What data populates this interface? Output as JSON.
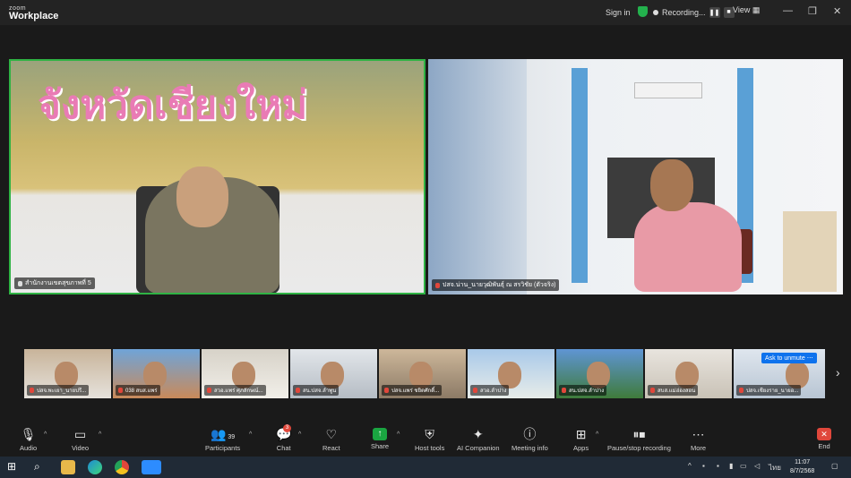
{
  "app": {
    "brand_small": "zoom",
    "brand_large": "Workplace"
  },
  "titlebar": {
    "signin": "Sign in",
    "recording": "Recording...",
    "view": "View"
  },
  "main_tiles": [
    {
      "banner": "จังหวัดเชียงใหม่",
      "name": "สำนักงานเขตสุขภาพที่ 5"
    },
    {
      "name": "ปสจ.น่าน_นายวุฒิพันธุ์ ณ สรวิชัย (ตัวจริง)"
    }
  ],
  "thumbnails": [
    "ปสจ.พะเยา_นายปรี...",
    "038 สบส.แพร่",
    "สวอ.แพร่ ศุภลักษณ์...",
    "สน.ปสจ.ลำพูน",
    "ปสจ.แพร่ ชยิตศักดิ์...",
    "สวอ.ลำปาง",
    "สน.ปสจ.ลำปาง",
    "สบส.แม่ฮ่องสอน",
    "ปสจ.เชียงราย_นายอ..."
  ],
  "ask_to_unmute": "Ask to unmute",
  "toolbar": {
    "audio": "Audio",
    "video": "Video",
    "participants": "Participants",
    "participants_count": "39",
    "chat": "Chat",
    "chat_badge": "3",
    "react": "React",
    "share": "Share",
    "host_tools": "Host tools",
    "ai_companion": "AI Companion",
    "meeting_info": "Meeting info",
    "apps": "Apps",
    "pause_stop": "Pause/stop recording",
    "more": "More",
    "end": "End"
  },
  "taskbar": {
    "lang": "ไทย",
    "time": "11:07",
    "date": "8/7/2568"
  },
  "colors": {
    "active_speaker": "#2fb344",
    "share_green": "#1aa541",
    "end_red": "#e0473b",
    "accent_blue": "#0e72ed"
  }
}
